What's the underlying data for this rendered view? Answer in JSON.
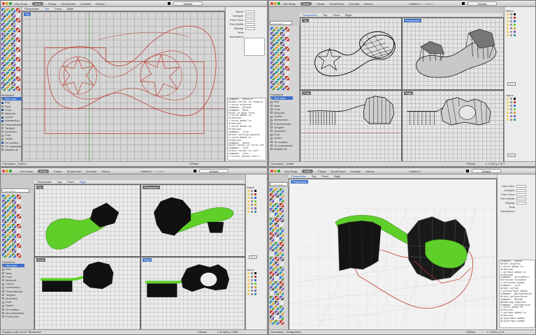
{
  "colors": {
    "accent": "#3d70c9",
    "curve": "#c0392b",
    "green": "#5fcf2a",
    "solid": "#111111"
  },
  "tabs": [
    "Grid Snap",
    "Ortho",
    "Planar",
    "SmartTrack",
    "Gumball",
    "History"
  ],
  "q1": {
    "tab_active": "Ortho",
    "viewport": "Top",
    "view_tabs": [
      "Perspective",
      "Top",
      "Front",
      "Right"
    ],
    "active_view": "Top",
    "layer": "Default",
    "props": [
      "Name:",
      "Linetype:",
      "Print Color:",
      "Print Width:",
      "Display:",
      "Note description:"
    ],
    "osnap_header": "Persistent",
    "osnap": [
      "One shot",
      "End",
      "Near",
      "Point",
      "Midpoint",
      "Center",
      "Intersection",
      "Perpendicular",
      "Tangent",
      "Quadrant",
      "Knot",
      "Vertex",
      "On surface",
      "On polysurface",
      "Disable all"
    ],
    "osnap_checked": [
      false,
      true,
      false,
      true,
      false,
      true,
      true,
      false,
      false,
      false,
      false,
      false,
      true,
      false,
      false
    ],
    "history": [
      "Command: _Rebuild",
      "Select curves to rebuild",
      "1 curve selected",
      "Command: _Rotate",
      "Command: _Move",
      "Point to move from",
      "1 curve added to selection",
      "1 curve added to selection",
      "1 curve added to selection",
      "Command: _Trim",
      "Select cutting objects",
      "1 curve added to selection",
      "Command: _Scale",
      "Scale factor or first ref",
      "Command: _Loft",
      "Select curves to loft",
      "Command: _Join",
      "2 curves joined into 1"
    ],
    "status": "Command: _SelCrv",
    "status_right": "CPlane"
  },
  "q2": {
    "title": "Untitled 2",
    "edited": "— Edited",
    "layer": "Default",
    "cmd_placeholder": "Command",
    "view_tabs": [
      "Perspective",
      "Top",
      "Front",
      "Right"
    ],
    "active_view": "Perspective",
    "viewports": [
      "Top",
      "Perspective",
      "Front",
      "Right"
    ],
    "layers_header": "Name",
    "osnap_header": "Persistent",
    "osnap": [
      "One shot",
      "End",
      "Near",
      "Point",
      "Midpoint",
      "Center",
      "Intersection",
      "Perpendicular",
      "Tangent",
      "Quadrant",
      "Knot",
      "Vertex",
      "On surface",
      "On polysurface",
      "Disable all"
    ],
    "status": "Command: _SelAll",
    "status_right": "CPlane",
    "coords": "x 1.134   y 1.477"
  },
  "q3": {
    "title": "Untitled 2",
    "edited": "— Edited",
    "layer": "Default",
    "cmd_placeholder": "Command",
    "view_tabs": [
      "Perspective",
      "Top",
      "Front",
      "Right"
    ],
    "active_view": "Right",
    "viewports": [
      "Top",
      "Perspective",
      "Front",
      "Right"
    ],
    "layers_header": "Name",
    "osnap_header": "Persistent",
    "osnap": [
      "One shot",
      "End",
      "Near",
      "Point",
      "Midpoint",
      "Center",
      "Intersection",
      "Perpendicular",
      "Tangent",
      "Quadrant",
      "Knot",
      "Vertex",
      "On surface",
      "On polysurface",
      "Point point"
    ],
    "status": "Display mode set to \"Rendered\"",
    "status_right": "CPlane",
    "coords": "x 32.803  y 4.280"
  },
  "q4": {
    "title": "Untitled 2",
    "layer": "Default",
    "cmd_placeholder": "Command",
    "view_tabs": [
      "Perspective",
      "Top",
      "Front",
      "Right"
    ],
    "active_view": "Perspective",
    "viewport": "Perspective",
    "props": [
      "Line Color:",
      "Linetype:",
      "Print Color:",
      "Print Width:",
      "Display:",
      "Note description:"
    ],
    "history": [
      "Command: _Shade",
      "Select objects",
      "1 curve added to selection",
      "1 surface added to selection",
      "Command: _ExtrudeCrv",
      "Extrusion distance",
      "1 extrusion added",
      "Command: _Loft",
      "Select curves",
      "1 polysurface added",
      "Command: _BooleanUnion",
      "Select polysurfaces",
      "Command: _Render",
      "Rendering complete",
      "Command: _Perspective",
      "1 curve added to selection",
      "1 surface added to selection",
      "polysurface added",
      "polysurface added"
    ],
    "status": "Command: _Perspective",
    "status_right": "CPlane",
    "coords": "x -23.61  y 4.9"
  }
}
